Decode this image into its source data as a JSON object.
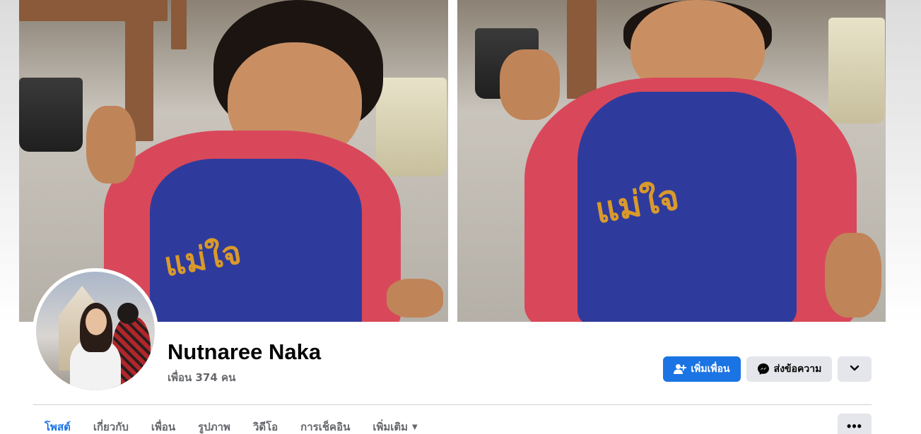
{
  "profile": {
    "name": "Nutnaree Naka",
    "friends_label": "เพื่อน 374 คน"
  },
  "actions": {
    "add_friend_label": "เพิ่มเพื่อน",
    "message_label": "ส่งข้อความ",
    "more_icon": "chevron-down-icon"
  },
  "tabs": [
    {
      "label": "โพสต์",
      "active": true
    },
    {
      "label": "เกี่ยวกับ",
      "active": false
    },
    {
      "label": "เพื่อน",
      "active": false
    },
    {
      "label": "รูปภาพ",
      "active": false
    },
    {
      "label": "วิดีโอ",
      "active": false
    },
    {
      "label": "การเช็คอิน",
      "active": false
    },
    {
      "label": "เพิ่มเติม",
      "active": false
    }
  ],
  "tab_overflow_icon": "ellipsis-icon",
  "colors": {
    "accent": "#1b74e4",
    "secondary_button": "#e4e6eb",
    "text_primary": "#050505",
    "text_secondary": "#65676b"
  }
}
